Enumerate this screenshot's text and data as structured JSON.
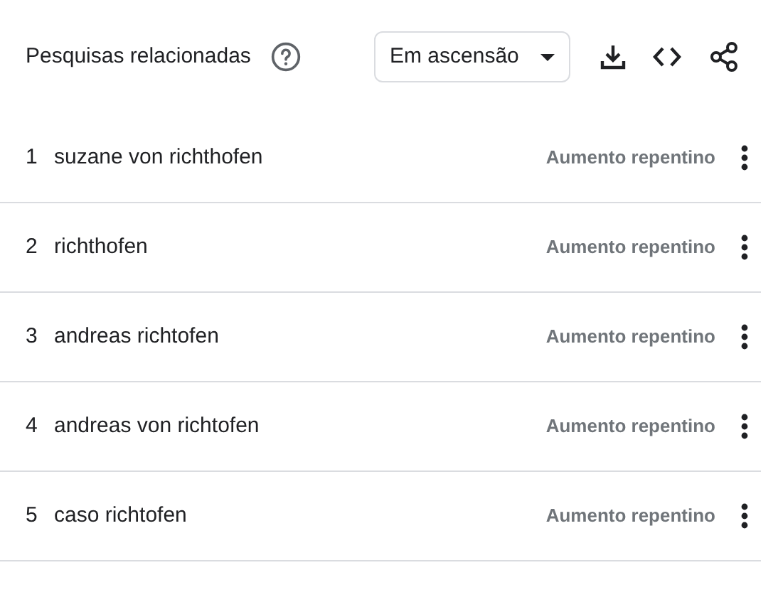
{
  "header": {
    "title": "Pesquisas relacionadas",
    "dropdown": {
      "value": "Em ascensão"
    }
  },
  "rows": [
    {
      "rank": "1",
      "query": "suzane von richthofen",
      "value": "Aumento repentino"
    },
    {
      "rank": "2",
      "query": "richthofen",
      "value": "Aumento repentino"
    },
    {
      "rank": "3",
      "query": "andreas richtofen",
      "value": "Aumento repentino"
    },
    {
      "rank": "4",
      "query": "andreas von richtofen",
      "value": "Aumento repentino"
    },
    {
      "rank": "5",
      "query": "caso richtofen",
      "value": "Aumento repentino"
    }
  ]
}
